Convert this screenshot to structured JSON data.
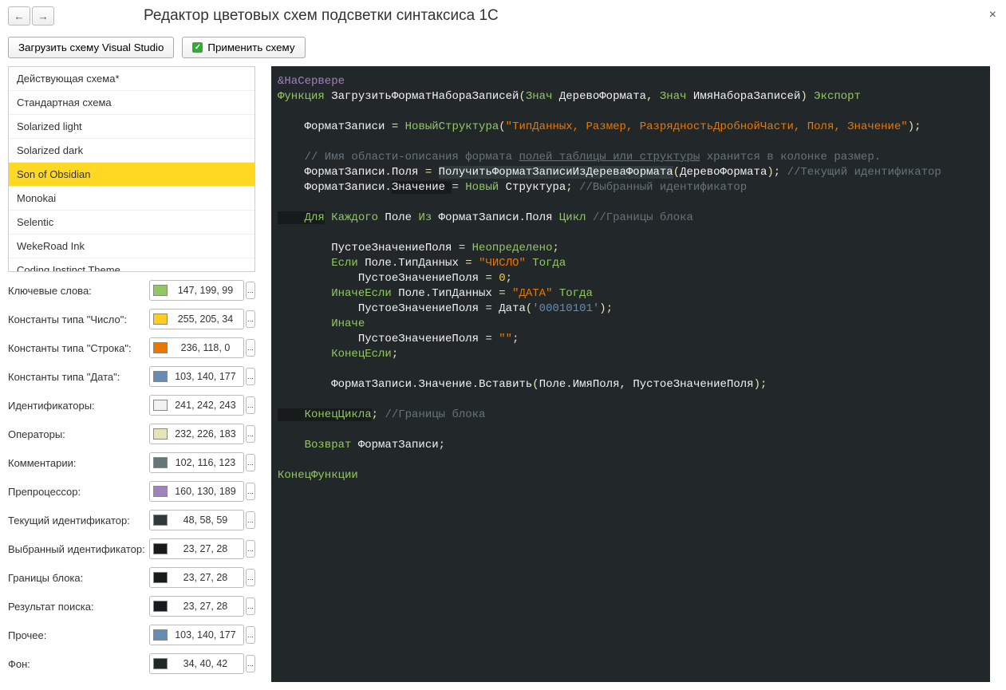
{
  "title": "Редактор цветовых схем подсветки синтаксиса 1С",
  "toolbar": {
    "load": "Загрузить схему Visual Studio",
    "apply": "Применить схему"
  },
  "schemes": [
    "Действующая схема*",
    "Стандартная схема",
    "Solarized light",
    "Solarized dark",
    "Son of Obsidian",
    "Monokai",
    "Selentic",
    "WekeRoad Ink",
    "Coding Instinct Theme"
  ],
  "selected_index": 4,
  "props": [
    {
      "label": "Ключевые слова:",
      "rgb": "147, 199, 99",
      "hex": "#93c763"
    },
    {
      "label": "Константы типа \"Число\":",
      "rgb": "255, 205, 34",
      "hex": "#ffcd22"
    },
    {
      "label": "Константы типа \"Строка\":",
      "rgb": "236, 118, 0",
      "hex": "#ec7600"
    },
    {
      "label": "Константы типа \"Дата\":",
      "rgb": "103, 140, 177",
      "hex": "#678cb1"
    },
    {
      "label": "Идентификаторы:",
      "rgb": "241, 242, 243",
      "hex": "#f1f2f3"
    },
    {
      "label": "Операторы:",
      "rgb": "232, 226, 183",
      "hex": "#e8e2b7"
    },
    {
      "label": "Комментарии:",
      "rgb": "102, 116, 123",
      "hex": "#66747b"
    },
    {
      "label": "Препроцессор:",
      "rgb": "160, 130, 189",
      "hex": "#a082bd"
    },
    {
      "label": "Текущий идентификатор:",
      "rgb": "48, 58, 59",
      "hex": "#303a3b"
    },
    {
      "label": "Выбранный идентификатор:",
      "rgb": "23, 27, 28",
      "hex": "#171b1c"
    },
    {
      "label": "Границы блока:",
      "rgb": "23, 27, 28",
      "hex": "#171b1c"
    },
    {
      "label": "Результат поиска:",
      "rgb": "23, 27, 28",
      "hex": "#171b1c"
    },
    {
      "label": "Прочее:",
      "rgb": "103, 140, 177",
      "hex": "#678cb1"
    },
    {
      "label": "Фон:",
      "rgb": "34, 40, 42",
      "hex": "#22282a"
    }
  ],
  "code": {
    "l1": "&НаСервере",
    "l2a": "Функция",
    "l2b": " ЗагрузитьФорматНабораЗаписей",
    "l2c": "(",
    "l2d": "Знач",
    "l2e": " ДеревоФормата",
    "l2f": ", ",
    "l2g": "Знач",
    "l2h": " ИмяНабораЗаписей",
    "l2i": ")",
    "l2j": " Экспорт",
    "l4a": "    ФорматЗаписи ",
    "l4b": "= ",
    "l4c": "НовыйСтруктура",
    "l4d": "(",
    "l4e": "\"ТипДанных, Размер, РазрядностьДробнойЧасти, Поля, Значение\"",
    "l4f": ");",
    "l6": "    // Имя области-описания формата ",
    "l6u": "полей таблицы или структуры",
    "l6b": " хранится в колонке размер.",
    "l7a": "    ФорматЗаписи",
    "l7b": ".",
    "l7c": "Поля ",
    "l7d": "= ",
    "l7e": "ПолучитьФорматЗаписиИзДереваФормата",
    "l7f": "(",
    "l7g": "ДеревоФормата",
    "l7h": "); ",
    "l7i": "//Текущий идентификатор",
    "l8a": "    ФорматЗаписи",
    "l8b": ".",
    "l8c": "Значение ",
    "l8d": "= ",
    "l8e": "Новый",
    "l8f": " Структура",
    "l8g": "; ",
    "l8h": "//Выбранный идентификатор",
    "l10a": "    Для",
    "l10b": " Каждого",
    "l10c": " Поле ",
    "l10d": "Из",
    "l10e": " ФорматЗаписи",
    "l10f": ".",
    "l10g": "Поля ",
    "l10h": "Цикл",
    "l10i": " //Границы блока",
    "l12a": "        ПустоеЗначениеПоля ",
    "l12b": "= ",
    "l12c": "Неопределено",
    "l12d": ";",
    "l13a": "        Если",
    "l13b": " Поле",
    "l13c": ".",
    "l13d": "ТипДанных ",
    "l13e": "= ",
    "l13f": "\"ЧИСЛО\"",
    "l13g": " Тогда",
    "l14a": "            ПустоеЗначениеПоля ",
    "l14b": "= ",
    "l14c": "0",
    "l14d": ";",
    "l15a": "        ИначеЕсли",
    "l15b": " Поле",
    "l15c": ".",
    "l15d": "ТипДанных ",
    "l15e": "= ",
    "l15f": "\"ДАТА\"",
    "l15g": " Тогда",
    "l16a": "            ПустоеЗначениеПоля ",
    "l16b": "= ",
    "l16c": "Дата",
    "l16d": "(",
    "l16e": "'00010101'",
    "l16f": ");",
    "l17": "        Иначе",
    "l18a": "            ПустоеЗначениеПоля ",
    "l18b": "= ",
    "l18c": "\"\"",
    "l18d": ";",
    "l19a": "        КонецЕсли",
    "l19b": ";",
    "l21a": "        ФорматЗаписи",
    "l21b": ".",
    "l21c": "Значение",
    "l21d": ".",
    "l21e": "Вставить",
    "l21f": "(",
    "l21g": "Поле",
    "l21h": ".",
    "l21i": "ИмяПоля",
    "l21j": ", ",
    "l21k": "ПустоеЗначениеПоля",
    "l21l": ");",
    "l23a": "    КонецЦикла",
    "l23b": "; ",
    "l23c": "//Границы блока",
    "l25a": "    Возврат",
    "l25b": " ФорматЗаписи",
    "l25c": ";",
    "l27": "КонецФункции"
  }
}
